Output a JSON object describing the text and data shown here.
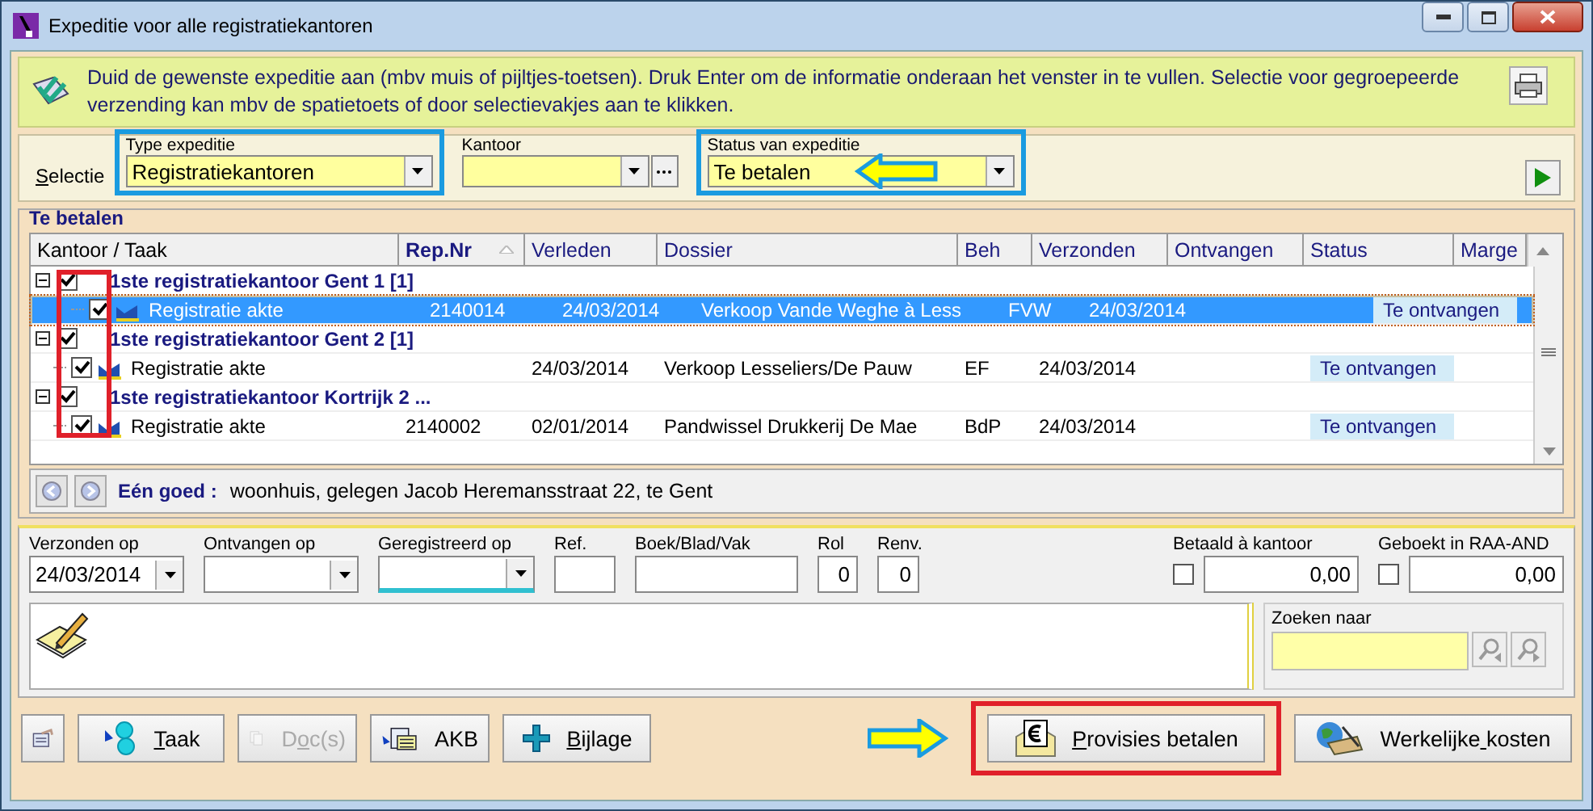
{
  "window": {
    "title": "Expeditie voor alle registratiekantoren"
  },
  "info": {
    "text": "Duid de gewenste expeditie aan (mbv muis of pijltjes-toetsen). Druk Enter om de informatie onderaan het venster in te vullen. Selectie voor gegroepeerde verzending kan mbv de spatietoets of door selectievakjes aan te klikken."
  },
  "selection": {
    "label": "Selectie",
    "fields": [
      {
        "kind": "combo",
        "label": "Type expeditie",
        "value": "Registratiekantoren",
        "highlighted": true,
        "arrow": false
      },
      {
        "kind": "lookup",
        "label": "Kantoor",
        "highlighted": false,
        "arrow": false
      },
      {
        "kind": "combo",
        "label": "Status van expeditie",
        "value": "Te betalen",
        "highlighted": true,
        "arrow": true
      }
    ]
  },
  "table": {
    "title": "Te betalen",
    "checkbox_highlight": true,
    "columns": [
      {
        "label": "Kantoor / Taak",
        "sorted": false
      },
      {
        "label": "Rep.Nr",
        "sorted": true
      },
      {
        "label": "Verleden",
        "sorted": false
      },
      {
        "label": "Dossier",
        "sorted": false
      },
      {
        "label": "Beh",
        "sorted": false
      },
      {
        "label": "Verzonden",
        "sorted": false
      },
      {
        "label": "Ontvangen",
        "sorted": false
      },
      {
        "label": "Status",
        "sorted": false
      },
      {
        "label": "Marge",
        "sorted": false
      }
    ],
    "groups": [
      {
        "title": "1ste registratiekantoor Gent 1 [1]",
        "expanded": true,
        "checked": true,
        "tasks": [
          {
            "label": "Registratie akte",
            "checked": true,
            "selected": true,
            "rep_nr": "2140014",
            "verleden": "24/03/2014",
            "dossier": "Verkoop Vande Weghe à Less",
            "beh": "FVW",
            "verzonden": "24/03/2014",
            "status": "Te ontvangen"
          }
        ]
      },
      {
        "title": "1ste registratiekantoor Gent 2 [1]",
        "expanded": true,
        "checked": true,
        "tasks": [
          {
            "label": "Registratie akte",
            "checked": true,
            "selected": false,
            "verleden": "24/03/2014",
            "dossier": "Verkoop Lesseliers/De Pauw",
            "beh": "EF",
            "verzonden": "24/03/2014",
            "status": "Te ontvangen"
          }
        ]
      },
      {
        "title": "1ste registratiekantoor Kortrijk 2 ...",
        "expanded": true,
        "checked": true,
        "tasks": [
          {
            "label": "Registratie akte",
            "checked": true,
            "selected": false,
            "rep_nr": "2140002",
            "verleden": "02/01/2014",
            "dossier": "Pandwissel Drukkerij De Mae",
            "beh": "BdP",
            "verzonden": "24/03/2014",
            "status": "Te ontvangen"
          }
        ]
      }
    ],
    "detail_label": "Eén goed :",
    "detail_text": "woonhuis, gelegen Jacob Heremansstraat 22, te Gent"
  },
  "form": {
    "fields": [
      {
        "kind": "date",
        "label": "Verzonden op",
        "value": "24/03/2014",
        "focused": false
      },
      {
        "kind": "date",
        "label": "Ontvangen op",
        "focused": false
      },
      {
        "kind": "date",
        "label": "Geregistreerd op",
        "focused": true
      },
      {
        "kind": "text",
        "label": "Ref."
      },
      {
        "kind": "text",
        "label": "Boek/Blad/Vak"
      },
      {
        "kind": "number",
        "label": "Rol",
        "value": "0"
      },
      {
        "kind": "number",
        "label": "Renv.",
        "value": "0"
      }
    ],
    "amounts": [
      {
        "label": "Betaald à kantoor",
        "checked": false,
        "value": "0,00"
      },
      {
        "label": "Geboekt in RAA-AND",
        "checked": false,
        "value": "0,00"
      }
    ],
    "search_label": "Zoeken naar"
  },
  "buttons": [
    {
      "kind": "properties",
      "disabled": false,
      "highlighted": false,
      "arrow": false
    },
    {
      "kind": "task",
      "label": "Taak",
      "disabled": false,
      "highlighted": false,
      "arrow": false
    },
    {
      "kind": "docs",
      "label": "Doc(s)",
      "disabled": true,
      "highlighted": false,
      "arrow": false
    },
    {
      "kind": "akb",
      "label": "AKB",
      "disabled": false,
      "highlighted": false,
      "arrow": false
    },
    {
      "kind": "attach",
      "label": "Bijlage",
      "disabled": false,
      "highlighted": false,
      "arrow": false
    },
    {
      "kind": "pay",
      "label": "Provisies betalen",
      "disabled": false,
      "highlighted": true,
      "arrow": true
    },
    {
      "kind": "costs",
      "label": "Werkelijke kosten",
      "disabled": false,
      "highlighted": false,
      "arrow": false
    }
  ]
}
